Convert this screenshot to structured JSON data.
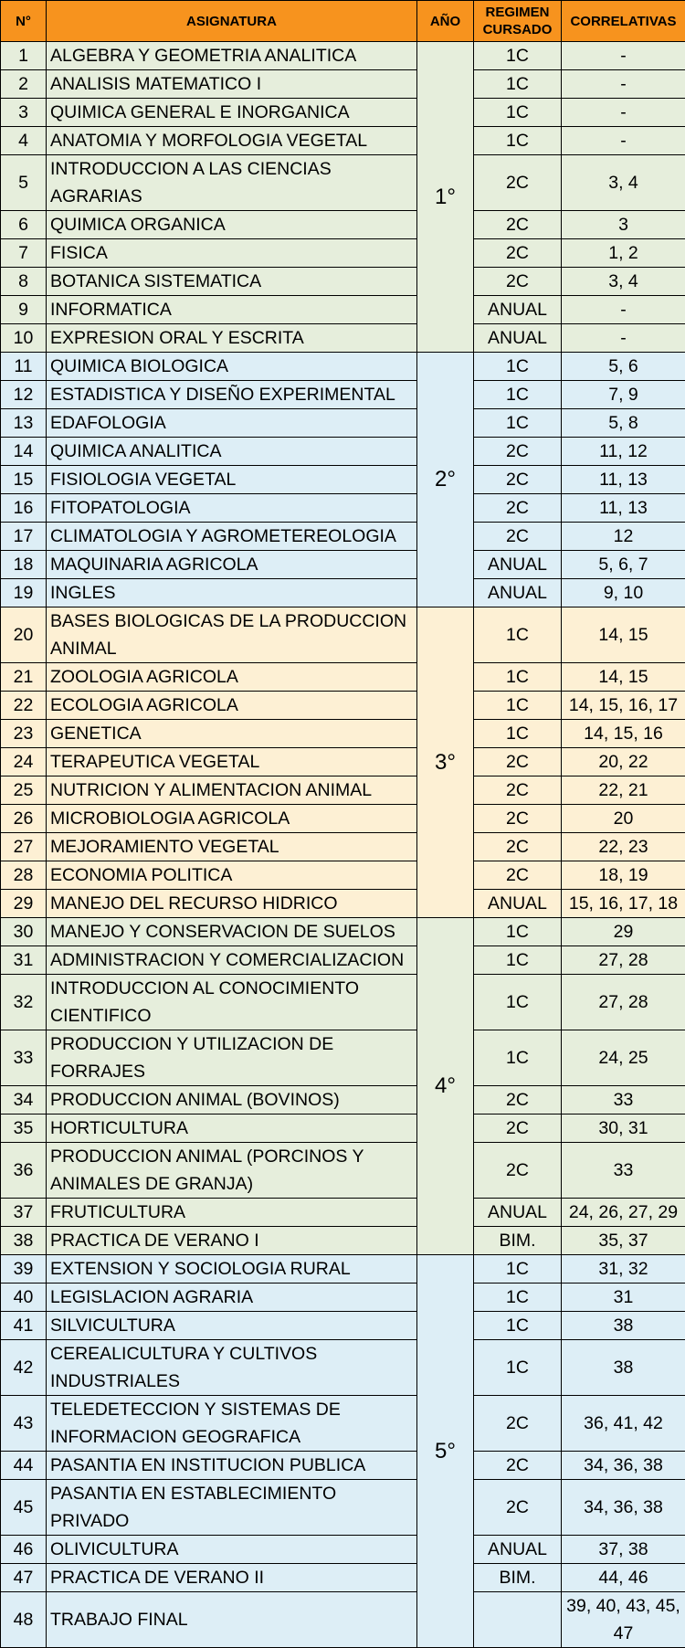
{
  "headers": {
    "n": "N°",
    "asignatura": "ASIGNATURA",
    "anio": "AÑO",
    "regimen": "REGIMEN CURSADO",
    "correlativas": "CORRELATIVAS"
  },
  "years": [
    {
      "label": "1°",
      "color": "#e6eedc",
      "rows": [
        {
          "n": "1",
          "name": "ALGEBRA Y GEOMETRIA ANALITICA",
          "reg": "1C",
          "cor": "-"
        },
        {
          "n": "2",
          "name": "ANALISIS MATEMATICO I",
          "reg": "1C",
          "cor": "-"
        },
        {
          "n": "3",
          "name": "QUIMICA GENERAL E INORGANICA",
          "reg": "1C",
          "cor": "-"
        },
        {
          "n": "4",
          "name": "ANATOMIA Y MORFOLOGIA VEGETAL",
          "reg": "1C",
          "cor": "-"
        },
        {
          "n": "5",
          "name": "INTRODUCCION A LAS CIENCIAS AGRARIAS",
          "reg": "2C",
          "cor": "3, 4"
        },
        {
          "n": "6",
          "name": "QUIMICA ORGANICA",
          "reg": "2C",
          "cor": "3"
        },
        {
          "n": "7",
          "name": "FISICA",
          "reg": "2C",
          "cor": "1, 2"
        },
        {
          "n": "8",
          "name": "BOTANICA SISTEMATICA",
          "reg": "2C",
          "cor": "3, 4"
        },
        {
          "n": "9",
          "name": "INFORMATICA",
          "reg": "ANUAL",
          "cor": "-"
        },
        {
          "n": "10",
          "name": "EXPRESION ORAL Y ESCRITA",
          "reg": "ANUAL",
          "cor": "-"
        }
      ]
    },
    {
      "label": "2°",
      "color": "#ddeef6",
      "rows": [
        {
          "n": "11",
          "name": "QUIMICA BIOLOGICA",
          "reg": "1C",
          "cor": "5, 6"
        },
        {
          "n": "12",
          "name": "ESTADISTICA Y DISEÑO EXPERIMENTAL",
          "reg": "1C",
          "cor": "7, 9"
        },
        {
          "n": "13",
          "name": "EDAFOLOGIA",
          "reg": "1C",
          "cor": "5, 8"
        },
        {
          "n": "14",
          "name": "QUIMICA ANALITICA",
          "reg": "2C",
          "cor": "11, 12"
        },
        {
          "n": "15",
          "name": "FISIOLOGIA VEGETAL",
          "reg": "2C",
          "cor": "11, 13"
        },
        {
          "n": "16",
          "name": "FITOPATOLOGIA",
          "reg": "2C",
          "cor": "11, 13"
        },
        {
          "n": "17",
          "name": "CLIMATOLOGIA Y AGROMETEREOLOGIA",
          "reg": "2C",
          "cor": "12"
        },
        {
          "n": "18",
          "name": "MAQUINARIA AGRICOLA",
          "reg": "ANUAL",
          "cor": "5, 6, 7"
        },
        {
          "n": "19",
          "name": "INGLES",
          "reg": "ANUAL",
          "cor": "9, 10"
        }
      ]
    },
    {
      "label": "3°",
      "color": "#fdf0d4",
      "rows": [
        {
          "n": "20",
          "name": "BASES BIOLOGICAS DE LA PRODUCCION ANIMAL",
          "reg": "1C",
          "cor": "14, 15",
          "tall": true
        },
        {
          "n": "21",
          "name": "ZOOLOGIA AGRICOLA",
          "reg": "1C",
          "cor": "14, 15"
        },
        {
          "n": "22",
          "name": "ECOLOGIA AGRICOLA",
          "reg": "1C",
          "cor": "14, 15, 16, 17"
        },
        {
          "n": "23",
          "name": "GENETICA",
          "reg": "1C",
          "cor": "14, 15, 16"
        },
        {
          "n": "24",
          "name": "TERAPEUTICA VEGETAL",
          "reg": "2C",
          "cor": "20, 22"
        },
        {
          "n": "25",
          "name": "NUTRICION Y ALIMENTACION ANIMAL",
          "reg": "2C",
          "cor": "22, 21"
        },
        {
          "n": "26",
          "name": "MICROBIOLOGIA AGRICOLA",
          "reg": "2C",
          "cor": "20"
        },
        {
          "n": "27",
          "name": "MEJORAMIENTO VEGETAL",
          "reg": "2C",
          "cor": "22, 23"
        },
        {
          "n": "28",
          "name": "ECONOMIA POLITICA",
          "reg": "2C",
          "cor": "18, 19"
        },
        {
          "n": "29",
          "name": "MANEJO DEL RECURSO HIDRICO",
          "reg": "ANUAL",
          "cor": "15, 16, 17, 18"
        }
      ]
    },
    {
      "label": "4°",
      "color": "#e6eedc",
      "rows": [
        {
          "n": "30",
          "name": "MANEJO Y CONSERVACION DE SUELOS",
          "reg": "1C",
          "cor": "29"
        },
        {
          "n": "31",
          "name": "ADMINISTRACION Y COMERCIALIZACION",
          "reg": "1C",
          "cor": "27, 28"
        },
        {
          "n": "32",
          "name": "INTRODUCCION AL CONOCIMIENTO CIENTIFICO",
          "reg": "1C",
          "cor": "27, 28",
          "tall": true
        },
        {
          "n": "33",
          "name": "PRODUCCION Y UTILIZACION DE FORRAJES",
          "reg": "1C",
          "cor": "24, 25"
        },
        {
          "n": "34",
          "name": "PRODUCCION ANIMAL (BOVINOS)",
          "reg": "2C",
          "cor": "33"
        },
        {
          "n": "35",
          "name": "HORTICULTURA",
          "reg": "2C",
          "cor": "30, 31"
        },
        {
          "n": "36",
          "name": "PRODUCCION ANIMAL (PORCINOS Y ANIMALES DE GRANJA)",
          "reg": "2C",
          "cor": "33",
          "tall": true
        },
        {
          "n": "37",
          "name": "FRUTICULTURA",
          "reg": "ANUAL",
          "cor": "24, 26, 27, 29"
        },
        {
          "n": "38",
          "name": "PRACTICA DE VERANO I",
          "reg": "BIM.",
          "cor": "35, 37"
        }
      ]
    },
    {
      "label": "5°",
      "color": "#ddeef6",
      "rows": [
        {
          "n": "39",
          "name": "EXTENSION Y SOCIOLOGIA RURAL",
          "reg": "1C",
          "cor": "31, 32"
        },
        {
          "n": "40",
          "name": "LEGISLACION AGRARIA",
          "reg": "1C",
          "cor": "31"
        },
        {
          "n": "41",
          "name": "SILVICULTURA",
          "reg": "1C",
          "cor": "38"
        },
        {
          "n": "42",
          "name": "CEREALICULTURA Y CULTIVOS INDUSTRIALES",
          "reg": "1C",
          "cor": "38",
          "tall": true
        },
        {
          "n": "43",
          "name": "TELEDETECCION Y SISTEMAS DE INFORMACION GEOGRAFICA",
          "reg": "2C",
          "cor": "36, 41, 42",
          "tall": true
        },
        {
          "n": "44",
          "name": "PASANTIA EN INSTITUCION PUBLICA",
          "reg": "2C",
          "cor": "34, 36, 38"
        },
        {
          "n": "45",
          "name": "PASANTIA EN ESTABLECIMIENTO PRIVADO",
          "reg": "2C",
          "cor": "34, 36, 38",
          "tall": true
        },
        {
          "n": "46",
          "name": "OLIVICULTURA",
          "reg": "ANUAL",
          "cor": "37, 38"
        },
        {
          "n": "47",
          "name": "PRACTICA DE VERANO II",
          "reg": "BIM.",
          "cor": "44, 46"
        },
        {
          "n": "48",
          "name": "TRABAJO FINAL",
          "reg": "",
          "cor": "39, 40, 43, 45, 47",
          "tall": true
        }
      ]
    }
  ]
}
